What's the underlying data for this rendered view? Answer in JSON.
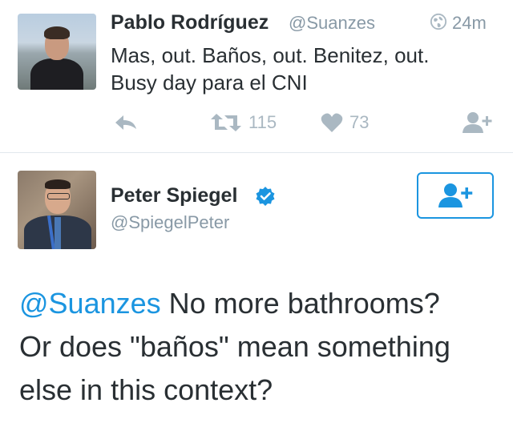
{
  "tweet": {
    "author_name": "Pablo Rodríguez",
    "author_handle": "@Suanzes",
    "time": "24m",
    "text_line1": "Mas, out. Baños, out. Benitez, out.",
    "text_line2": "Busy day para el CNI",
    "actions": {
      "reply_icon": "reply-icon",
      "retweet_icon": "retweet-icon",
      "retweet_count": "115",
      "like_icon": "heart-icon",
      "like_count": "73",
      "follow_icon": "follow-user-icon"
    }
  },
  "reply": {
    "author_name": "Peter Spiegel",
    "author_handle": "@SpiegelPeter",
    "verified_icon": "verified-badge-icon",
    "follow_button_icon": "follow-user-icon",
    "mention": "@Suanzes",
    "text_line1_rest": " No more bathrooms?",
    "text_line2": "Or does \"baños\" mean something",
    "text_line3": "else in this context?"
  },
  "colors": {
    "accent": "#1b95e0",
    "muted": "#8899a6",
    "icon_muted": "#aab8c2",
    "text": "#292f33"
  }
}
